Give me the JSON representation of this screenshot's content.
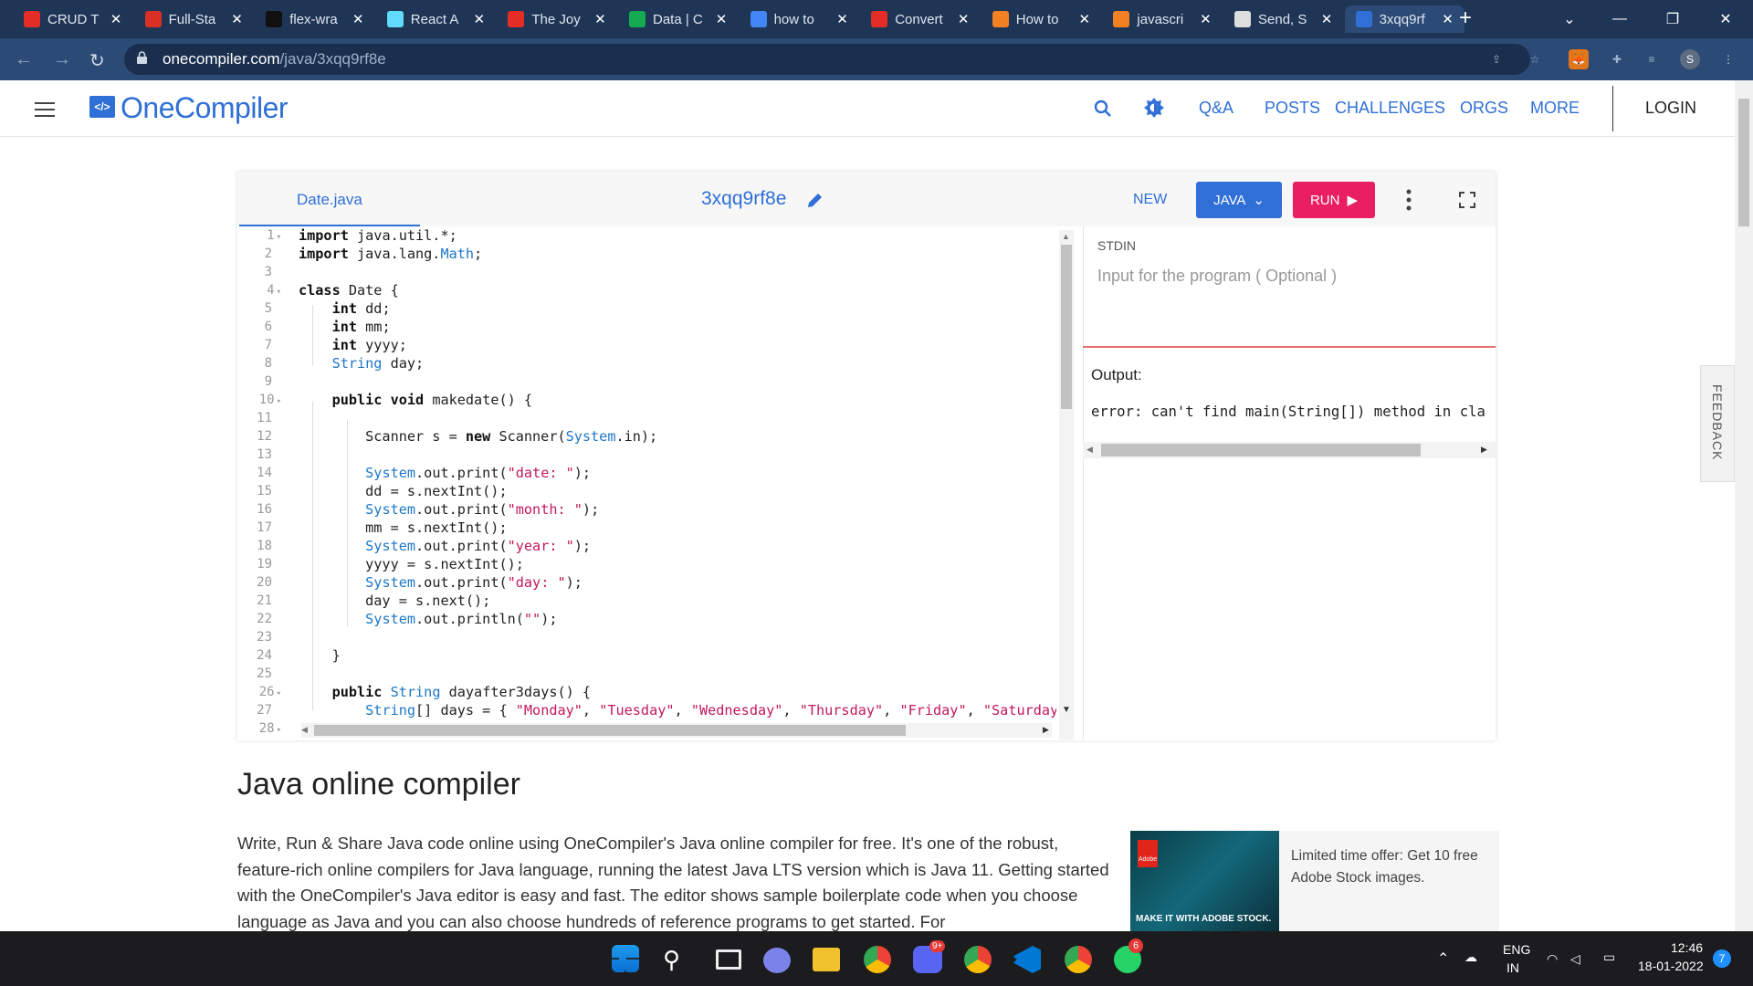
{
  "browser": {
    "tabs": [
      {
        "title": "CRUD T",
        "icon": "youtube-icon",
        "color": "#e52d27"
      },
      {
        "title": "Full-Sta",
        "icon": "gmail-icon",
        "color": "#d93025"
      },
      {
        "title": "flex-wra",
        "icon": "github-icon",
        "color": "#111111"
      },
      {
        "title": "React A",
        "icon": "react-icon",
        "color": "#61dafb"
      },
      {
        "title": "The Joy",
        "icon": "youtube-icon",
        "color": "#e52d27"
      },
      {
        "title": "Data | C",
        "icon": "mongodb-icon",
        "color": "#13aa52"
      },
      {
        "title": "how to",
        "icon": "google-icon",
        "color": "#4285f4"
      },
      {
        "title": "Convert",
        "icon": "youtube-icon",
        "color": "#e52d27"
      },
      {
        "title": "How to",
        "icon": "stackoverflow-icon",
        "color": "#f48024"
      },
      {
        "title": "javascri",
        "icon": "stackoverflow-icon",
        "color": "#f48024"
      },
      {
        "title": "Send, S",
        "icon": "globe-icon",
        "color": "#dddddd"
      },
      {
        "title": "3xqq9rf",
        "icon": "onecompiler-icon",
        "color": "#2f6fd6",
        "active": true
      }
    ],
    "close_glyph": "✕",
    "new_tab_glyph": "+",
    "url_host": "onecompiler.com",
    "url_path": "/java/3xqq9rf8e",
    "profile_initial": "S"
  },
  "site": {
    "logo_text": "OneCompiler",
    "logo_glyph": "</>",
    "nav": [
      "Q&A",
      "POSTS",
      "CHALLENGES",
      "ORGS",
      "MORE"
    ],
    "login": "LOGIN"
  },
  "editor": {
    "file_tab": "Date.java",
    "project_name": "3xqq9rf8e",
    "new_label": "NEW",
    "language_label": "JAVA",
    "run_label": "RUN",
    "line_numbers": [
      "1",
      "2",
      "3",
      "4",
      "5",
      "6",
      "7",
      "8",
      "9",
      "10",
      "11",
      "12",
      "13",
      "14",
      "15",
      "16",
      "17",
      "18",
      "19",
      "20",
      "21",
      "22",
      "23",
      "24",
      "25",
      "26",
      "27",
      "28"
    ],
    "fold_lines": [
      1,
      4,
      10,
      26,
      28
    ]
  },
  "io": {
    "stdin_label": "STDIN",
    "stdin_placeholder": "Input for the program ( Optional )",
    "output_label": "Output:",
    "output_text": "error: can't find main(String[]) method in cla"
  },
  "feedback_label": "FEEDBACK",
  "article": {
    "heading": "Java online compiler",
    "paragraph": "Write, Run & Share Java code online using OneCompiler's Java online compiler for free. It's one of the robust, feature-rich online compilers for Java language, running the latest Java LTS version which is Java 11. Getting started with the OneCompiler's Java editor is easy and fast. The editor shows sample boilerplate code when you choose language as Java and you can also choose hundreds of reference programs to get started. For"
  },
  "ad": {
    "text": "Limited time offer: Get 10 free Adobe Stock images.",
    "caption": "MAKE IT WITH ADOBE STOCK.",
    "brand": "Adobe"
  },
  "taskbar": {
    "lang_top": "ENG",
    "lang_bottom": "IN",
    "time": "12:46",
    "date": "18-01-2022",
    "notif_count": "7",
    "discord_badge": "9+",
    "whatsapp_badge": "6"
  }
}
